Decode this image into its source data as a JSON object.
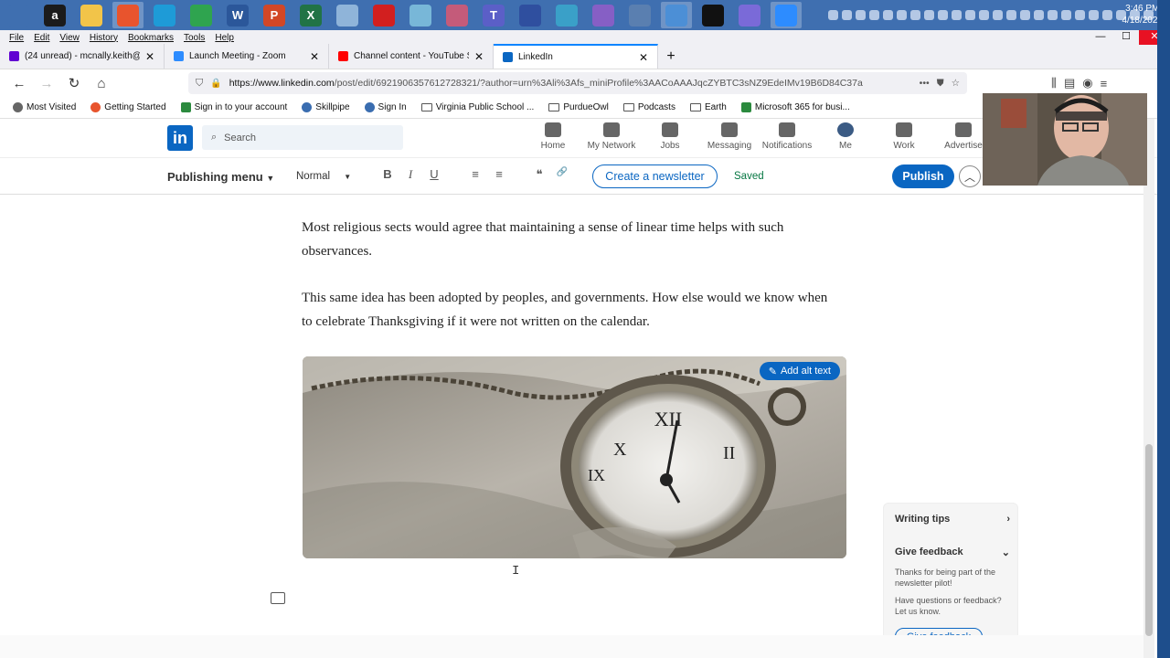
{
  "taskbar": {
    "apps": [
      {
        "name": "windows-start",
        "glyph": "",
        "color": "#3f6fb0"
      },
      {
        "name": "amazon",
        "glyph": "a",
        "color": "#1b1b1b"
      },
      {
        "name": "file-explorer",
        "glyph": "",
        "color": "#f2c449"
      },
      {
        "name": "firefox",
        "glyph": "",
        "color": "#e8542d"
      },
      {
        "name": "edge",
        "glyph": "",
        "color": "#1e9bd7"
      },
      {
        "name": "chrome",
        "glyph": "",
        "color": "#2fa44f"
      },
      {
        "name": "word",
        "glyph": "W",
        "color": "#2b579a"
      },
      {
        "name": "powerpoint",
        "glyph": "P",
        "color": "#d24726"
      },
      {
        "name": "excel",
        "glyph": "X",
        "color": "#217346"
      },
      {
        "name": "paint",
        "glyph": "",
        "color": "#8fb4d9"
      },
      {
        "name": "acrobat",
        "glyph": "",
        "color": "#d21f1f"
      },
      {
        "name": "notepad",
        "glyph": "",
        "color": "#78b7d8"
      },
      {
        "name": "snipping",
        "glyph": "",
        "color": "#c45b7a"
      },
      {
        "name": "teams",
        "glyph": "T",
        "color": "#5b5fc7"
      },
      {
        "name": "app-a",
        "glyph": "",
        "color": "#2f4f9f"
      },
      {
        "name": "app-b",
        "glyph": "",
        "color": "#3aa0c8"
      },
      {
        "name": "visual-studio",
        "glyph": "",
        "color": "#865fc5"
      },
      {
        "name": "app-c",
        "glyph": "",
        "color": "#5a7fb0"
      },
      {
        "name": "app-d",
        "glyph": "",
        "color": "#4c8fd6"
      },
      {
        "name": "terminal",
        "glyph": "",
        "color": "#111111"
      },
      {
        "name": "app-e",
        "glyph": "",
        "color": "#7a6ad8"
      },
      {
        "name": "zoom",
        "glyph": "",
        "color": "#2d8cff"
      }
    ],
    "time": "3:46 PM",
    "date": "4/18/2022"
  },
  "menubar": [
    "File",
    "Edit",
    "View",
    "History",
    "Bookmarks",
    "Tools",
    "Help"
  ],
  "tabs": [
    {
      "title": "(24 unread) - mcnally.keith@y",
      "color": "#6001d2",
      "active": false
    },
    {
      "title": "Launch Meeting - Zoom",
      "color": "#2d8cff",
      "active": false
    },
    {
      "title": "Channel content - YouTube St",
      "color": "#ff0000",
      "active": false
    },
    {
      "title": "LinkedIn",
      "color": "#0a66c2",
      "active": true
    }
  ],
  "newtab": "+",
  "address": {
    "host": "https://www.linkedin.com",
    "path": "/post/edit/6921906357612728321/?author=urn%3Ali%3Afs_miniProfile%3AACoAAAJqcZYBTC3sNZ9EdeIMv19B6D84C37a",
    "more": "•••"
  },
  "bookmarks": [
    {
      "label": "Most Visited",
      "icon": "gear"
    },
    {
      "label": "Getting Started",
      "icon": "firefox"
    },
    {
      "label": "Sign in to your account",
      "icon": "ms"
    },
    {
      "label": "Skillpipe",
      "icon": "globe"
    },
    {
      "label": "Sign In",
      "icon": "globe"
    },
    {
      "label": "Virginia Public School ...",
      "icon": "folder"
    },
    {
      "label": "PurdueOwl",
      "icon": "folder"
    },
    {
      "label": "Podcasts",
      "icon": "folder"
    },
    {
      "label": "Earth",
      "icon": "folder"
    },
    {
      "label": "Microsoft 365 for busi...",
      "icon": "ms"
    }
  ],
  "linkedin": {
    "logo": "in",
    "search_placeholder": "Search",
    "nav": [
      "Home",
      "My Network",
      "Jobs",
      "Messaging",
      "Notifications",
      "Me",
      "Work",
      "Advertise"
    ]
  },
  "toolbar": {
    "publishing_menu": "Publishing menu",
    "style": "Normal",
    "bold": "B",
    "italic": "I",
    "underline": "U",
    "numbered": "≡",
    "bulleted": "≡",
    "quote": "❝",
    "link": "🔗",
    "newsletter": "Create a newsletter",
    "saved": "Saved",
    "publish": "Publish",
    "collapse": "︿"
  },
  "article": {
    "p1": "Most religious sects would agree that maintaining a sense of linear time helps with such observances.",
    "p2": "This same idea has been adopted by peoples, and governments. How else would we know when to celebrate Thanksgiving if it were not written on the calendar.",
    "alt_text_button": "Add alt text"
  },
  "helper": {
    "writing_tips": "Writing tips",
    "give_feedback_heading": "Give feedback",
    "text1": "Thanks for being part of the newsletter pilot!",
    "text2": "Have questions or feedback? Let us know.",
    "give_feedback_button": "Give feedback"
  }
}
